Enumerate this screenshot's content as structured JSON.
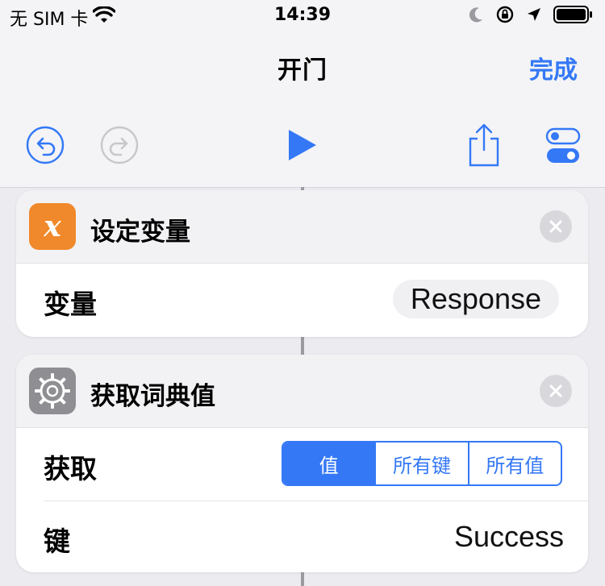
{
  "status_bar": {
    "carrier": "无 SIM 卡",
    "time": "14:39",
    "icons": [
      "wifi-icon",
      "moon-icon",
      "orientation-lock-icon",
      "location-icon",
      "battery-icon"
    ]
  },
  "nav": {
    "title": "开门",
    "done_label": "完成"
  },
  "toolbar": {
    "icons": [
      "undo-icon",
      "redo-icon",
      "play-icon",
      "share-icon",
      "settings-toggle-icon"
    ]
  },
  "actions": [
    {
      "icon": "variable-x-icon",
      "icon_glyph": "x",
      "icon_color": "#f0892b",
      "title": "设定变量",
      "rows": [
        {
          "label": "变量",
          "value": "Response"
        }
      ]
    },
    {
      "icon": "gear-icon",
      "icon_color": "#8e8e93",
      "title": "获取词典值",
      "rows": [
        {
          "label": "获取",
          "segments": [
            "值",
            "所有键",
            "所有值"
          ],
          "selected_segment": "值"
        },
        {
          "label": "键",
          "value": "Success"
        }
      ]
    }
  ],
  "colors": {
    "accent": "#3478f6",
    "background": "#ebebf0",
    "card": "#ffffff"
  }
}
